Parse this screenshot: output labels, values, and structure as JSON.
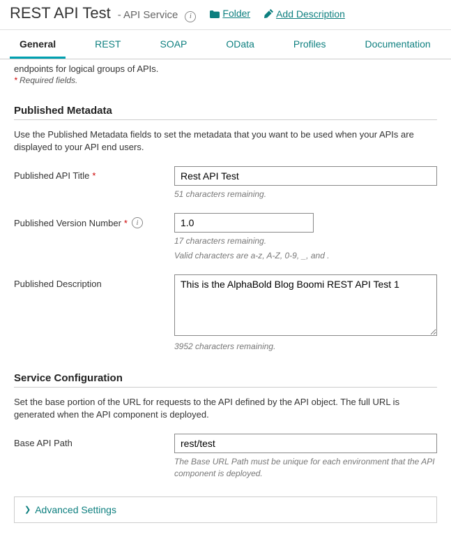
{
  "header": {
    "title": "REST API Test",
    "subtitle": "- API Service",
    "folder_link": "Folder",
    "add_desc_link": "Add Description"
  },
  "tabs": {
    "general": "General",
    "rest": "REST",
    "soap": "SOAP",
    "odata": "OData",
    "profiles": "Profiles",
    "documentation": "Documentation"
  },
  "intro": {
    "endpoint_note": "endpoints for logical groups of APIs.",
    "required_note": "Required fields."
  },
  "pub_meta": {
    "heading": "Published Metadata",
    "desc": "Use the Published Metadata fields to set the metadata that you want to be used when your APIs are displayed to your API end users.",
    "title_label": "Published API Title",
    "title_value": "Rest API Test",
    "title_helper": "51 characters remaining.",
    "version_label": "Published Version Number",
    "version_value": "1.0",
    "version_helper1": "17 characters remaining.",
    "version_helper2": "Valid characters are a-z, A-Z, 0-9, _, and .",
    "desc_label": "Published Description",
    "desc_value": "This is the AlphaBold Blog Boomi REST API Test 1",
    "desc_helper": "3952 characters remaining."
  },
  "svc_config": {
    "heading": "Service Configuration",
    "desc": "Set the base portion of the URL for requests to the API defined by the API object. The full URL is generated when the API component is deployed.",
    "path_label": "Base API Path",
    "path_value": "rest/test",
    "path_helper": "The Base URL Path must be unique for each environment that the API component is deployed."
  },
  "advanced": {
    "label": "Advanced Settings"
  }
}
